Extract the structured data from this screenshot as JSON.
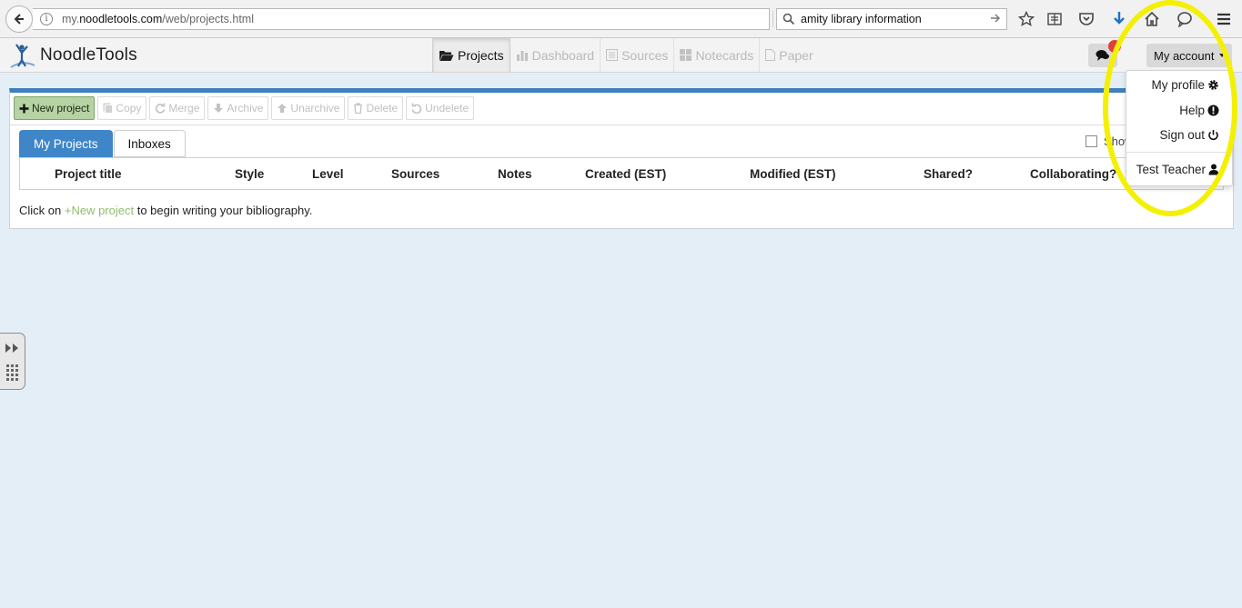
{
  "browser": {
    "url_prefix": "my.",
    "url_host": "noodletools.com",
    "url_path": "/web/projects.html",
    "search_value": "amity library information"
  },
  "app": {
    "logo_text": "NoodleTools",
    "nav": [
      {
        "label": "Projects",
        "icon": "folder-open-icon",
        "active": true
      },
      {
        "label": "Dashboard",
        "icon": "bar-chart-icon",
        "active": false
      },
      {
        "label": "Sources",
        "icon": "list-icon",
        "active": false
      },
      {
        "label": "Notecards",
        "icon": "grid-icon",
        "active": false
      },
      {
        "label": "Paper",
        "icon": "document-icon",
        "active": false
      }
    ],
    "account_label": "My account"
  },
  "toolbar": {
    "new_project": "New project",
    "copy": "Copy",
    "merge": "Merge",
    "archive": "Archive",
    "unarchive": "Unarchive",
    "delete": "Delete",
    "undelete": "Undelete"
  },
  "tabs": {
    "my_projects": "My Projects",
    "inboxes": "Inboxes"
  },
  "show_checkbox_label": "Show",
  "table": {
    "columns": [
      "Project title",
      "Style",
      "Level",
      "Sources",
      "Notes",
      "Created (EST)",
      "Modified (EST)",
      "Shared?",
      "Collaborating?"
    ]
  },
  "empty_message": {
    "prefix": "Click on ",
    "link": "+New project",
    "suffix": " to begin writing your bibliography."
  },
  "account_menu": {
    "profile": "My profile",
    "help": "Help",
    "sign_out": "Sign out",
    "user": "Test Teacher"
  },
  "colors": {
    "accent": "#3f86c9",
    "new_project_button": "#b6d3a3",
    "highlight": "#f4f003",
    "background": "#e4eef7"
  }
}
